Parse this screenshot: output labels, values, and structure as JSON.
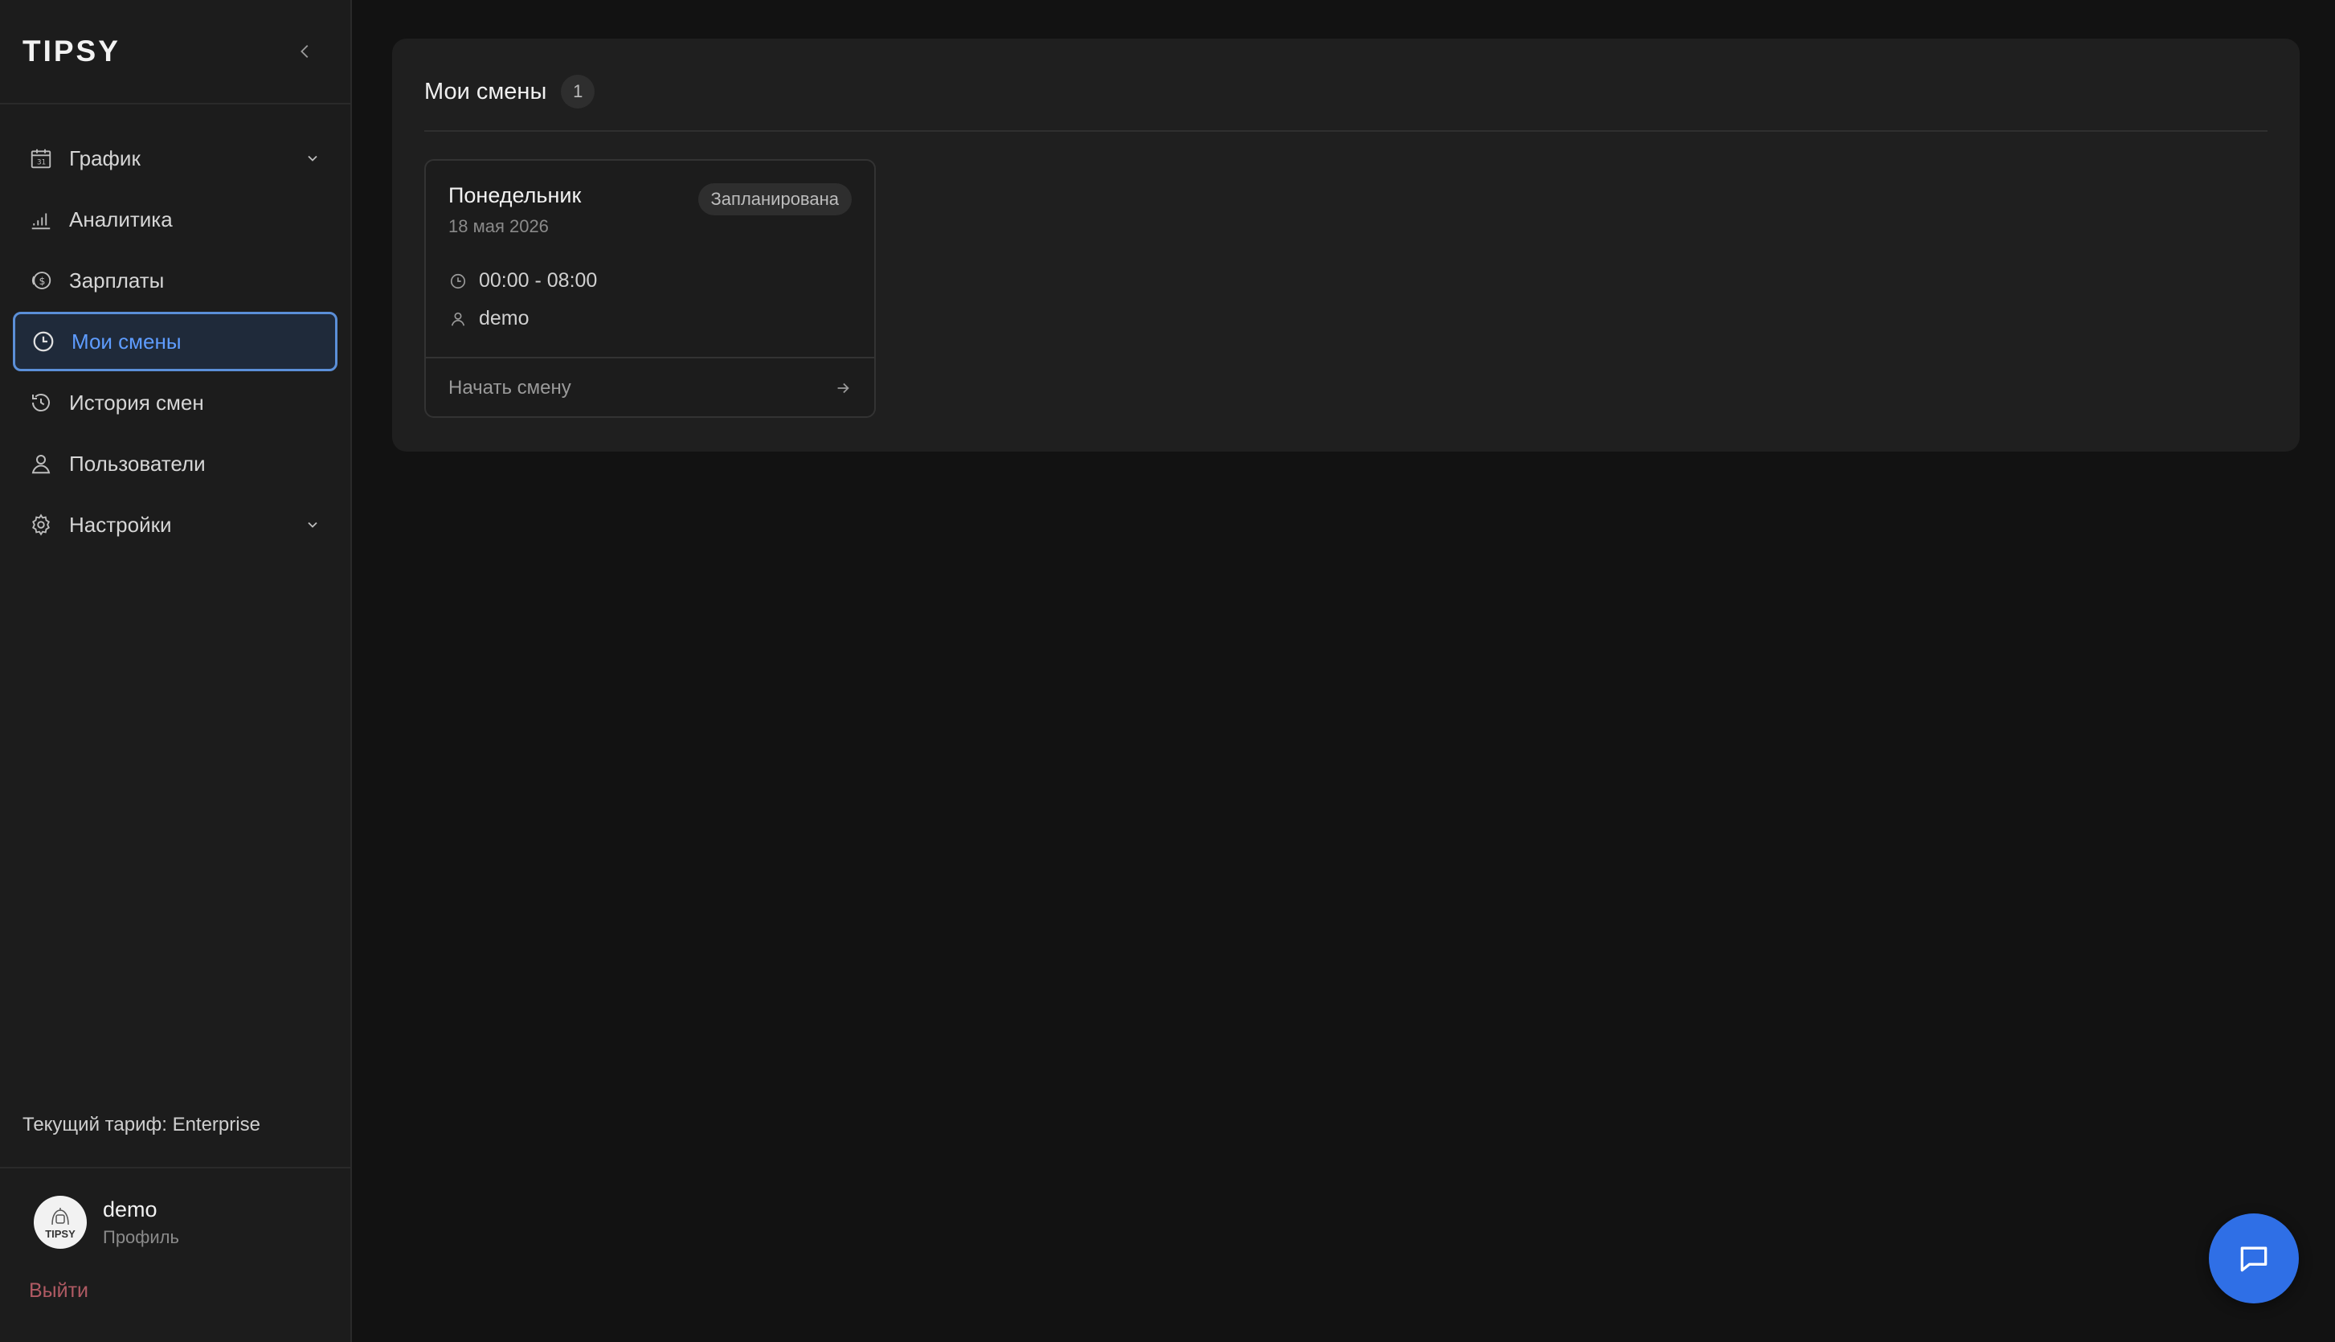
{
  "brand": {
    "name": "TIPSY"
  },
  "sidebar": {
    "items": [
      {
        "label": "График",
        "icon": "calendar-icon",
        "has_submenu": true
      },
      {
        "label": "Аналитика",
        "icon": "bar-chart-icon",
        "has_submenu": false
      },
      {
        "label": "Зарплаты",
        "icon": "money-icon",
        "has_submenu": false
      },
      {
        "label": "Мои смены",
        "icon": "clock-icon",
        "has_submenu": false,
        "active": true
      },
      {
        "label": "История смен",
        "icon": "history-icon",
        "has_submenu": false
      },
      {
        "label": "Пользователи",
        "icon": "user-icon",
        "has_submenu": false
      },
      {
        "label": "Настройки",
        "icon": "gear-icon",
        "has_submenu": true
      }
    ],
    "tariff": "Текущий тариф: Enterprise",
    "profile": {
      "name": "demo",
      "subtitle": "Профиль",
      "avatar_text": "TIPSY"
    },
    "logout": "Выйти"
  },
  "main": {
    "title": "Мои смены",
    "count": "1",
    "shifts": [
      {
        "day": "Понедельник",
        "date": "18 мая 2026",
        "status": "Запланирована",
        "time": "00:00 - 08:00",
        "user": "demo",
        "action": "Начать смену"
      }
    ]
  },
  "colors": {
    "background": "#121212",
    "sidebar": "#1c1c1c",
    "panel": "#1f1f1f",
    "accent": "#5e9cff",
    "logout": "#b05a63",
    "fab": "#2f6fe6"
  }
}
